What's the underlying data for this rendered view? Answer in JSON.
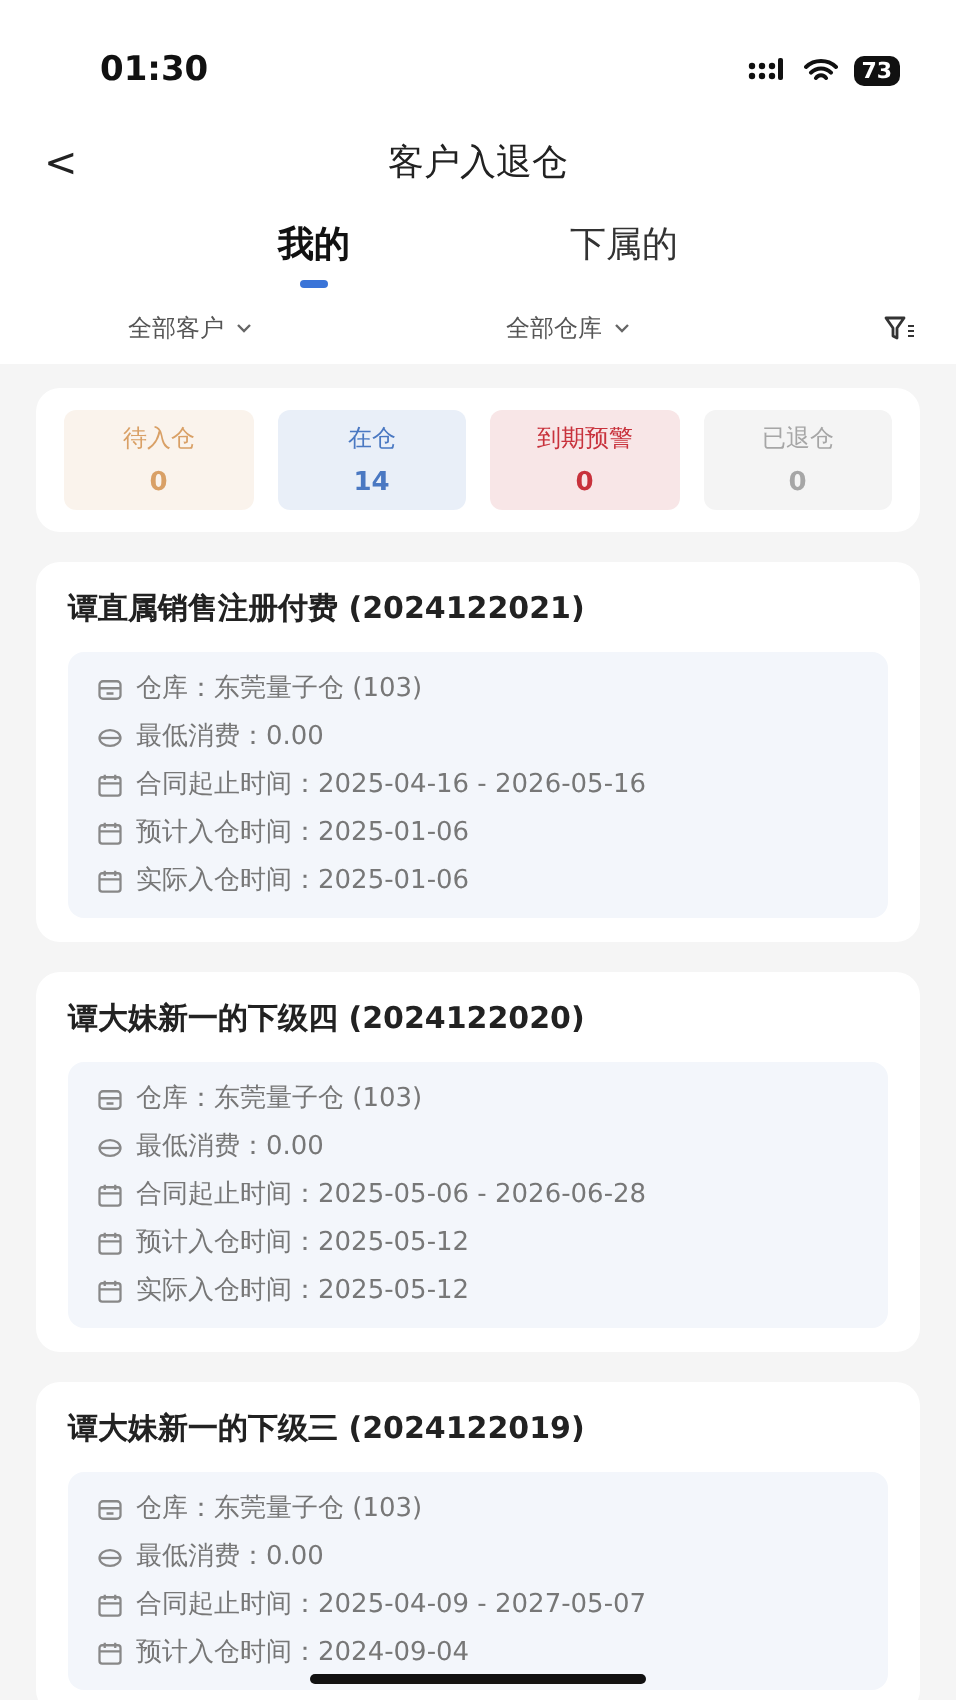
{
  "status_bar": {
    "time": "01:30",
    "battery": "73"
  },
  "header": {
    "back": "<",
    "title": "客户入退仓"
  },
  "tabs": [
    {
      "label": "我的",
      "selected": true
    },
    {
      "label": "下属的",
      "selected": false
    }
  ],
  "filters": [
    {
      "label": "全部客户"
    },
    {
      "label": "全部仓库"
    }
  ],
  "stats": [
    {
      "label": "待入仓",
      "count": "0",
      "color": "#d9a066"
    },
    {
      "label": "在仓",
      "count": "14",
      "color": "#4a78c2"
    },
    {
      "label": "到期预警",
      "count": "0",
      "color": "#c8323c"
    },
    {
      "label": "已退仓",
      "count": "0",
      "color": "#a6a6a6"
    }
  ],
  "cards": [
    {
      "title": "谭直属销售注册付费 (2024122021)",
      "rows": [
        {
          "kind": "warehouse",
          "text": "仓库：东莞量子仓 (103)"
        },
        {
          "kind": "coin",
          "text": "最低消费：0.00"
        },
        {
          "kind": "calendar",
          "text": "合同起止时间：2025-04-16 - 2026-05-16"
        },
        {
          "kind": "calendar",
          "text": "预计入仓时间：2025-01-06"
        },
        {
          "kind": "calendar",
          "text": "实际入仓时间：2025-01-06"
        }
      ]
    },
    {
      "title": "谭大妹新一的下级四 (2024122020)",
      "rows": [
        {
          "kind": "warehouse",
          "text": "仓库：东莞量子仓 (103)"
        },
        {
          "kind": "coin",
          "text": "最低消费：0.00"
        },
        {
          "kind": "calendar",
          "text": "合同起止时间：2025-05-06 - 2026-06-28"
        },
        {
          "kind": "calendar",
          "text": "预计入仓时间：2025-05-12"
        },
        {
          "kind": "calendar",
          "text": "实际入仓时间：2025-05-12"
        }
      ]
    },
    {
      "title": "谭大妹新一的下级三 (2024122019)",
      "rows": [
        {
          "kind": "warehouse",
          "text": "仓库：东莞量子仓 (103)"
        },
        {
          "kind": "coin",
          "text": "最低消费：0.00"
        },
        {
          "kind": "calendar",
          "text": "合同起止时间：2025-04-09 - 2027-05-07"
        },
        {
          "kind": "calendar",
          "text": "预计入仓时间：2024-09-04"
        }
      ]
    }
  ]
}
